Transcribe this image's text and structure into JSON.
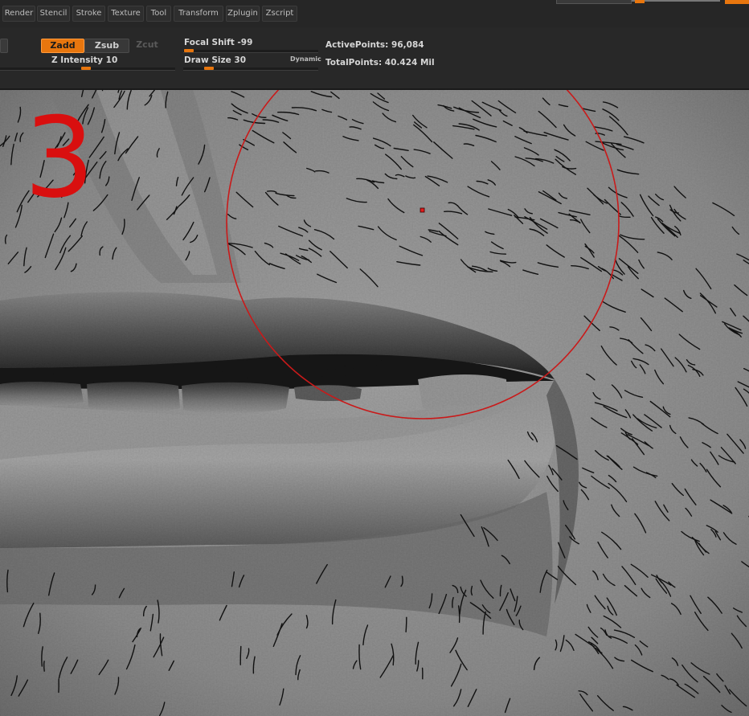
{
  "menubar": {
    "items": [
      "Render",
      "Stencil",
      "Stroke",
      "Texture",
      "Tool",
      "Transform",
      "Zplugin",
      "Zscript"
    ]
  },
  "toolbar": {
    "zadd_label": "Zadd",
    "zsub_label": "Zsub",
    "zcut_label": "Zcut",
    "z_intensity_label": "Z Intensity 10",
    "focal_shift_label": "Focal Shift -99",
    "draw_size_label": "Draw Size 30",
    "dynamic_label": "Dynamic",
    "active_points_label": "ActivePoints: 96,084",
    "total_points_label": "TotalPoints: 40.424 Mil"
  },
  "sliders": {
    "z_intensity": 10,
    "focal_shift": -99,
    "draw_size": 30
  },
  "colors": {
    "accent": "#e8760e",
    "brush_ring": "#c91a1a",
    "overlay_number": "#d90f0f"
  },
  "overlay": {
    "step_number": "3"
  }
}
